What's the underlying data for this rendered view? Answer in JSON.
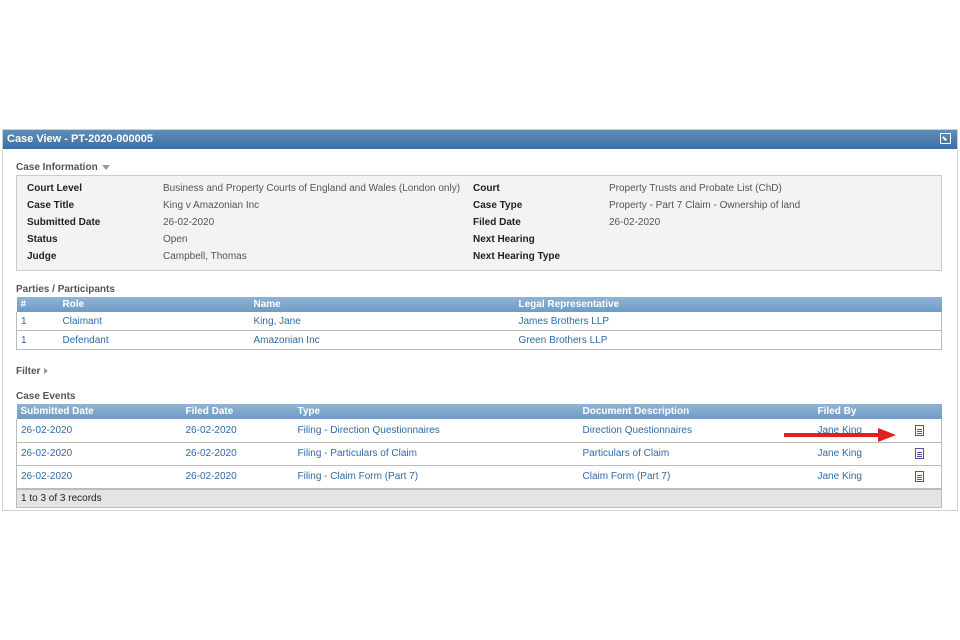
{
  "panel": {
    "title": "Case View - PT-2020-000005"
  },
  "case_info": {
    "section_label": "Case Information",
    "left": [
      {
        "label": "Court Level",
        "value": "Business and Property Courts of England and Wales (London only)"
      },
      {
        "label": "Case Title",
        "value": "King v Amazonian Inc"
      },
      {
        "label": "Submitted Date",
        "value": "26-02-2020"
      },
      {
        "label": "Status",
        "value": "Open"
      },
      {
        "label": "Judge",
        "value": "Campbell, Thomas"
      }
    ],
    "right": [
      {
        "label": "Court",
        "value": "Property Trusts and Probate List (ChD)"
      },
      {
        "label": "Case Type",
        "value": "Property - Part 7 Claim - Ownership of land"
      },
      {
        "label": "Filed Date",
        "value": "26-02-2020"
      },
      {
        "label": "Next Hearing",
        "value": ""
      },
      {
        "label": "Next Hearing Type",
        "value": ""
      }
    ]
  },
  "parties": {
    "section_label": "Parties / Participants",
    "columns": [
      "#",
      "Role",
      "Name",
      "Legal Representative"
    ],
    "rows": [
      [
        "1",
        "Claimant",
        "King, Jane",
        "James Brothers LLP"
      ],
      [
        "1",
        "Defendant",
        "Amazonian Inc",
        "Green Brothers LLP"
      ]
    ]
  },
  "filter": {
    "label": "Filter"
  },
  "events": {
    "section_label": "Case Events",
    "columns": [
      "Submitted Date",
      "Filed Date",
      "Type",
      "Document Description",
      "Filed By",
      ""
    ],
    "rows": [
      [
        "26-02-2020",
        "26-02-2020",
        "Filing - Direction Questionnaires",
        "Direction Questionnaires",
        "Jane King"
      ],
      [
        "26-02-2020",
        "26-02-2020",
        "Filing - Particulars of Claim",
        "Particulars of Claim",
        "Jane King"
      ],
      [
        "26-02-2020",
        "26-02-2020",
        "Filing - Claim Form (Part 7)",
        "Claim Form (Part 7)",
        "Jane King"
      ]
    ],
    "footer": "1 to 3 of 3 records"
  },
  "icons": {
    "expand": "expand-icon",
    "document": "document-icon",
    "annotation_arrow": "red-arrow"
  },
  "colors": {
    "header": "#4a7aab",
    "link": "#2f6aa7",
    "arrow": "#e0201b",
    "doc_icon": "#5d4bb5"
  }
}
